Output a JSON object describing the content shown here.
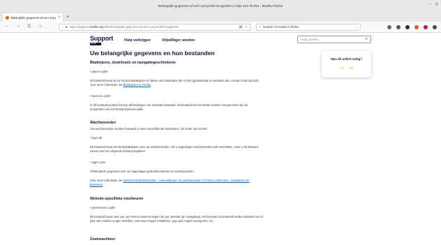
{
  "window": {
    "title": "Belangrijke gegevens uit een oud profiel terugzetten | Hulp voor Firefox - Mozilla Firefox",
    "controls": [
      "–",
      "⊡"
    ]
  },
  "tabs": [
    {
      "label": "Belangrijke gegevens uit een oud profiel terugzetten",
      "close": "×"
    }
  ],
  "new_tab": "+",
  "nav": {
    "back": "←",
    "forward": "→",
    "reload": "C",
    "home": "⌂"
  },
  "url": {
    "prefix": "https://support.",
    "host": "mozilla.org",
    "path": "/nl/kb/belangrijke-gegevens-uit-een-oud-profiel-terugzetten"
  },
  "find": {
    "value": "location of cookies in firefox",
    "arrow": "→"
  },
  "extensions": [
    {
      "color": "#6b6b6b"
    },
    {
      "color": "#555555"
    },
    {
      "color": "#2f2f2f"
    },
    {
      "color": "#e4572e"
    },
    {
      "color": "#c0143c"
    },
    {
      "color": "#4a4a4a"
    }
  ],
  "site": {
    "logo": "Support",
    "logo_sub": "Mozilla",
    "nav": [
      "Hulp verkrijgen",
      "Vrijwillliger worden"
    ],
    "search_placeholder": "Hulp zoeken..."
  },
  "article": {
    "title": "Uw belangrijke gegevens en hun bestanden",
    "sections": {
      "bookmarks": {
        "heading": "Bladwijzers, downloads en navigatiegeschiedenis",
        "file": "places.sqlite",
        "text_a": "Dit bestand bevat al uw Firefox-bladwijzers en lijsten van bestanden die u hebt gedownload en websites die u eerder hebt bezocht. Voor meer informatie, zie ",
        "link": "Bladwijzers in Firefox",
        "text_b": ".",
        "file2": "favicons.sqlite",
        "text2": "In dit bestand worden favicon-afbeeldingen van websites bewaard. Dit bestand kan het beste worden meegenomen bij het terugzetten van het bestand places.sqlite."
      },
      "passwords": {
        "heading": "Wachtwoorden",
        "intro": "Uw wachtwoorden worden bewaard in twee verschillende bestanden, die beide zijn vereist:",
        "file": "key4.db",
        "text": "Dit bestand bevat uw sleuteldatabase voor uw wachtwoorden. Als u opgeslagen wachtwoorden wilt overzetten, moet u dit bestand samen met het volgende bestand kopiëren.",
        "file2": "logins.json",
        "text2": "Versleutelde gegevens over uw opgeslagen gebruikersnamen en wachtwoorden.",
        "more_a": "Voor meer informatie, zie ",
        "more_link": "Wachtwoordenbeheerder – aanmeldingen en wachtwoorden in Firefox onthouden, verwijderen en bewerken",
        "more_b": "."
      },
      "site_prefs": {
        "heading": "Website-specifieke voorkeuren",
        "file": "permissions.sqlite",
        "text": "Dit bestand bevat veel van uw Firefox-toestemmingen die per website zijn vastgelegd. Het bewaart b(voorbeeld welke websites wel of juist niet cookies mogen instellen, extensies mogen installeren, pop-ups mogen weergeven, etc."
      },
      "search": {
        "heading": "Zoekmachines"
      }
    }
  },
  "feedback": {
    "question": "Was dit artikel nuttig?"
  }
}
